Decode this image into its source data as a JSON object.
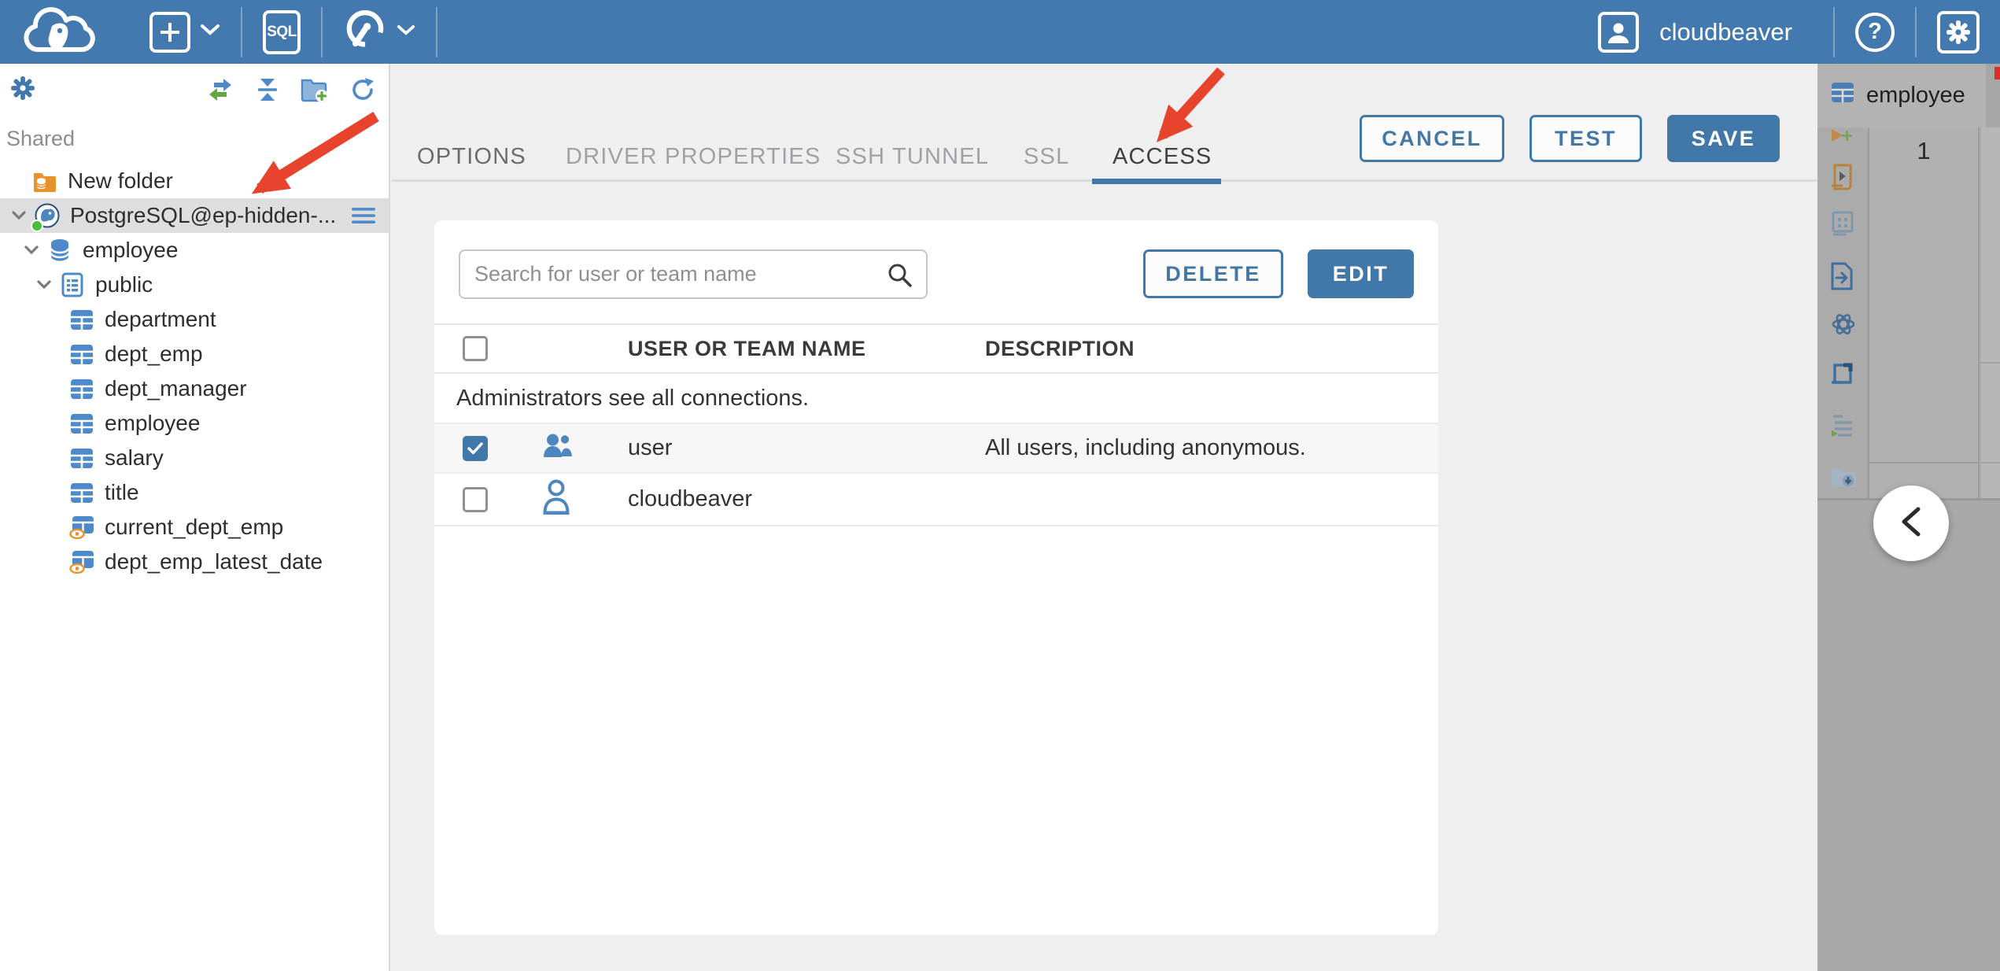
{
  "colors": {
    "header_blue": "#4379AF",
    "accent_blue": "#4178A9",
    "icon_blue": "#4E8AC9",
    "folder_orange": "#E8922E",
    "status_green": "#4CBE3C",
    "annotation_red": "#E8432C",
    "dimmed_panel_gray": "#ABABAB"
  },
  "header": {
    "sql_badge": "SQL",
    "help_glyph": "?",
    "user_label": "cloudbeaver"
  },
  "sidebar": {
    "section_label": "Shared",
    "items": [
      {
        "label": "New folder",
        "icon": "folder-database",
        "depth": 0
      },
      {
        "label": "PostgreSQL@ep-hidden-...",
        "icon": "postgresql",
        "depth": 0,
        "expanded": true,
        "selected": true,
        "status": "connected"
      },
      {
        "label": "employee",
        "icon": "database",
        "depth": 1,
        "expanded": true
      },
      {
        "label": "public",
        "icon": "schema",
        "depth": 2,
        "expanded": true
      },
      {
        "label": "department",
        "icon": "table",
        "depth": 3
      },
      {
        "label": "dept_emp",
        "icon": "table",
        "depth": 3
      },
      {
        "label": "dept_manager",
        "icon": "table",
        "depth": 3
      },
      {
        "label": "employee",
        "icon": "table",
        "depth": 3
      },
      {
        "label": "salary",
        "icon": "table",
        "depth": 3
      },
      {
        "label": "title",
        "icon": "table",
        "depth": 3
      },
      {
        "label": "current_dept_emp",
        "icon": "view",
        "depth": 3
      },
      {
        "label": "dept_emp_latest_date",
        "icon": "view",
        "depth": 3
      }
    ]
  },
  "dialog": {
    "tabs": [
      {
        "label": "OPTIONS",
        "state": "normal"
      },
      {
        "label": "DRIVER PROPERTIES",
        "state": "muted"
      },
      {
        "label": "SSH TUNNEL",
        "state": "muted"
      },
      {
        "label": "SSL",
        "state": "muted"
      },
      {
        "label": "ACCESS",
        "state": "active"
      }
    ],
    "actions": {
      "cancel": "CANCEL",
      "test": "TEST",
      "save": "SAVE"
    },
    "access": {
      "search_placeholder": "Search for user or team name",
      "delete_label": "DELETE",
      "edit_label": "EDIT",
      "columns": {
        "name": "USER OR TEAM NAME",
        "description": "DESCRIPTION"
      },
      "info_row": "Administrators see all connections.",
      "rows": [
        {
          "name": "user",
          "description": "All users, including anonymous.",
          "checked": true,
          "icon": "team",
          "selected": true
        },
        {
          "name": "cloudbeaver",
          "description": "",
          "checked": false,
          "icon": "user",
          "selected": false
        }
      ]
    }
  },
  "right_panel": {
    "tab_label": "employee",
    "row_number": "1"
  }
}
